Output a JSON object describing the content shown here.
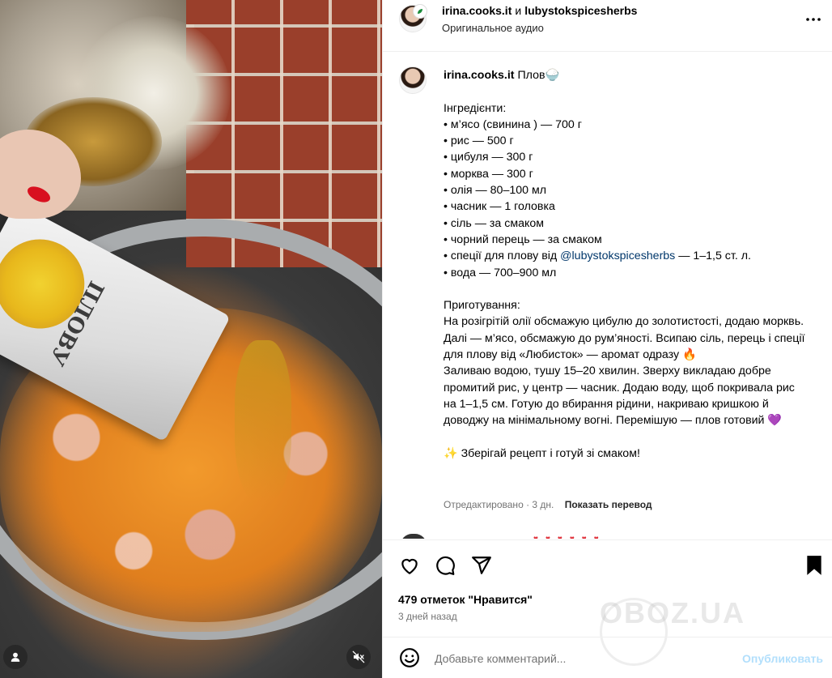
{
  "media": {
    "packet_label": "ПЛОВУ",
    "icons": [
      "user-icon",
      "mute-icon"
    ]
  },
  "header": {
    "author": "irina.cooks.it",
    "conjunction": "и",
    "collaborator": "lubystokspicesherbs",
    "audio": "Оригинальное аудио",
    "more_icon": "more-horizontal-icon"
  },
  "caption": {
    "username": "irina.cooks.it",
    "title": "Плов🍚",
    "ingredients_heading": "Інгредієнти:",
    "ingredients": [
      "• м’ясо (свинина ) — 700 г",
      "• рис — 500 г",
      "• цибуля — 300 г",
      "• морква — 300 г",
      "• олія — 80–100 мл",
      "• часник — 1 головка",
      "• сіль — за смаком",
      "• чорний перець — за смаком"
    ],
    "spice_prefix": "• спеції для плову від",
    "spice_mention": "@lubystokspicesherbs",
    "spice_suffix": "— 1–1,5 ст. л.",
    "water": "• вода — 700–900 мл",
    "prep_heading": "Приготування:",
    "prep_1": "На розігрітій олії обсмажую цибулю до золотистості, додаю морквь. Далі — м’ясо, обсмажую до рум’яності. Всипаю сіль, перець і спеції для плову від «Любисток» — аромат одразу 🔥",
    "prep_2": "Заливаю водою, тушу 15–20 хвилин. Зверху викладаю добре промитий рис, у центр — часник. Додаю воду, щоб покривала рис на 1–1,5 см. Готую до вбирання рідини, накриваю кришкою й доводжу на мінімальному вогні. Перемішую — плов готовий 💜",
    "closing": "✨ Зберігай рецепт і готуй зі смаком!",
    "edited": "Отредактировано · 3 дн.",
    "translate": "Показать перевод"
  },
  "actions": {
    "likes": "479 отметок \"Нравится\"",
    "ago": "3 дней назад",
    "icons": [
      "heart-icon",
      "comment-icon",
      "share-icon",
      "bookmark-icon"
    ]
  },
  "comment": {
    "placeholder": "Добавьте комментарий...",
    "publish": "Опубликовать"
  },
  "watermark": "OBOZ.UA",
  "colors": {
    "mention": "#00376b",
    "publish_disabled": "#b2dffc",
    "secondary_text": "#737373",
    "divider": "#efefef"
  }
}
